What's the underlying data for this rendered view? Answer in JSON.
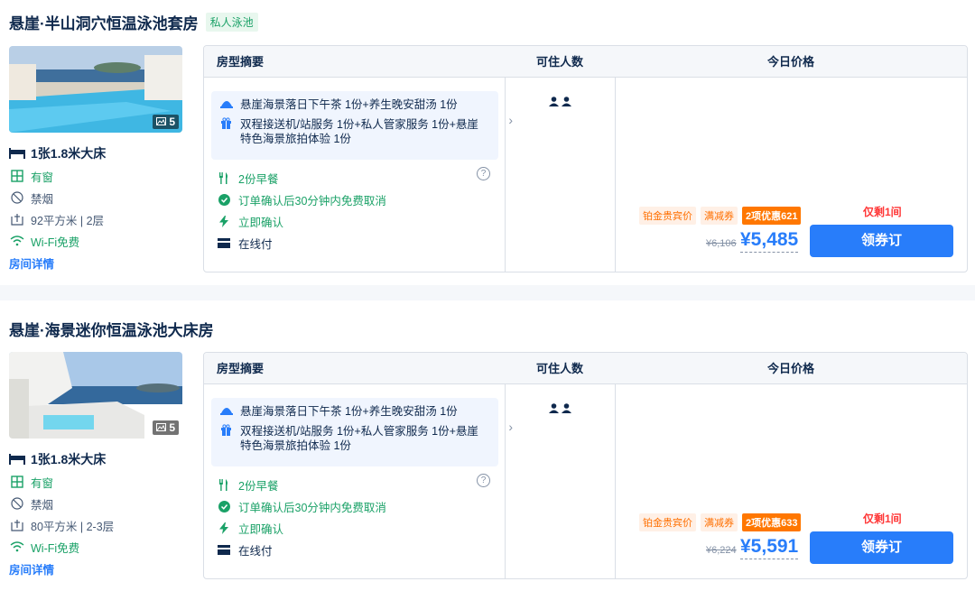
{
  "colors": {
    "accent": "#287dfa",
    "green": "#1aa167",
    "orange": "#ff7700",
    "red": "#ff3838",
    "text": "#0f294d"
  },
  "table_headers": {
    "summary": "房型摘要",
    "guests": "可住人数",
    "price": "今日价格"
  },
  "rooms": [
    {
      "title": "悬崖·半山洞穴恒温泳池套房",
      "tag": "私人泳池",
      "photo_count": "5",
      "bed": "1张1.8米大床",
      "window": "有窗",
      "smoking": "禁烟",
      "area": "92平方米 | 2层",
      "wifi": "Wi-Fi免费",
      "details_link": "房间详情",
      "package_line1": "悬崖海景落日下午茶 1份+养生晚安甜汤 1份",
      "package_line2": "双程接送机/站服务 1份+私人管家服务 1份+悬崖特色海景旅拍体验 1份",
      "breakfast": "2份早餐",
      "cancel": "订单确认后30分钟内免费取消",
      "instant": "立即确认",
      "payment": "在线付",
      "guests": 2,
      "badge1": "铂金贵宾价",
      "badge2": "满减券",
      "badge3": "2项优惠621",
      "left_count": "仅剩1间",
      "orig_price": "¥6,106",
      "price": "¥5,485",
      "book_label": "领券订"
    },
    {
      "title": "悬崖·海景迷你恒温泳池大床房",
      "tag": "",
      "photo_count": "5",
      "bed": "1张1.8米大床",
      "window": "有窗",
      "smoking": "禁烟",
      "area": "80平方米 | 2-3层",
      "wifi": "Wi-Fi免费",
      "details_link": "房间详情",
      "package_line1": "悬崖海景落日下午茶 1份+养生晚安甜汤 1份",
      "package_line2": "双程接送机/站服务 1份+私人管家服务 1份+悬崖特色海景旅拍体验 1份",
      "breakfast": "2份早餐",
      "cancel": "订单确认后30分钟内免费取消",
      "instant": "立即确认",
      "payment": "在线付",
      "guests": 2,
      "badge1": "铂金贵宾价",
      "badge2": "满减券",
      "badge3": "2项优惠633",
      "left_count": "仅剩1间",
      "orig_price": "¥6,224",
      "price": "¥5,591",
      "book_label": "领券订"
    }
  ]
}
